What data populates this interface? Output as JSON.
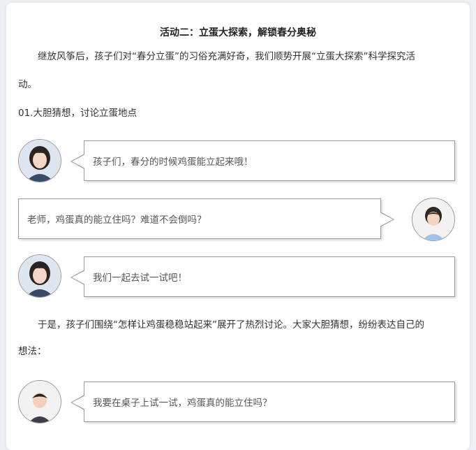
{
  "article": {
    "title": "活动二：立蛋大探索，解锁春分奥秘",
    "intro_line1": "继放风筝后，孩子们对“春分立蛋”的习俗充满好奇，我们顺势开展“立蛋大探索”科学探究活",
    "intro_line2": "动。",
    "section_title": "01.大胆猜想，讨论立蛋地点",
    "chat": [
      {
        "speaker": "teacher",
        "side": "left",
        "avatar_icon": "teacher-avatar-icon",
        "text": "孩子们，春分的时候鸡蛋能立起来哦！"
      },
      {
        "speaker": "girl",
        "side": "right",
        "avatar_icon": "child-girl-avatar-icon",
        "text": "老师，鸡蛋真的能立住吗？难道不会倒吗？"
      },
      {
        "speaker": "teacher",
        "side": "left",
        "avatar_icon": "teacher-avatar-icon",
        "text": "我们一起去试一试吧！"
      }
    ],
    "para2_line1": "于是，孩子们围绕“怎样让鸡蛋稳稳站起来”展开了热烈讨论。大家大胆猜想，纷纷表达自己的",
    "para2_line2": "想法：",
    "chat2": [
      {
        "speaker": "boy",
        "side": "left",
        "avatar_icon": "child-boy-avatar-icon",
        "text": "我要在桌子上试一试，鸡蛋真的能立住吗？"
      }
    ]
  },
  "colors": {
    "background": "#eef0f3",
    "card": "#ffffff",
    "bubble_border": "#9a9a9a",
    "text": "#333333"
  }
}
